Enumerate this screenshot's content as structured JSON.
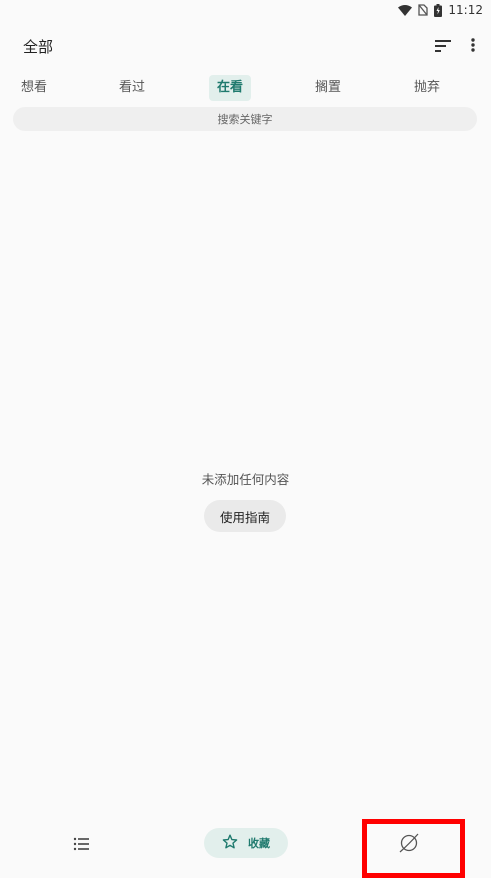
{
  "status_bar": {
    "time": "11:12"
  },
  "app_bar": {
    "title": "全部"
  },
  "tabs": [
    {
      "label": "想看",
      "active": false
    },
    {
      "label": "看过",
      "active": false
    },
    {
      "label": "在看",
      "active": true
    },
    {
      "label": "搁置",
      "active": false
    },
    {
      "label": "抛弃",
      "active": false
    }
  ],
  "search": {
    "placeholder": "搜索关键字"
  },
  "empty_state": {
    "message": "未添加任何内容",
    "guide_label": "使用指南"
  },
  "bottom_nav": {
    "list_icon": "list-icon",
    "favorites_label": "收藏",
    "favorites_icon": "star-icon",
    "explore_icon": "compass-icon"
  },
  "colors": {
    "accent": "#1f7a6e",
    "accent_bg": "#e2efec",
    "highlight": "#ff0000"
  }
}
